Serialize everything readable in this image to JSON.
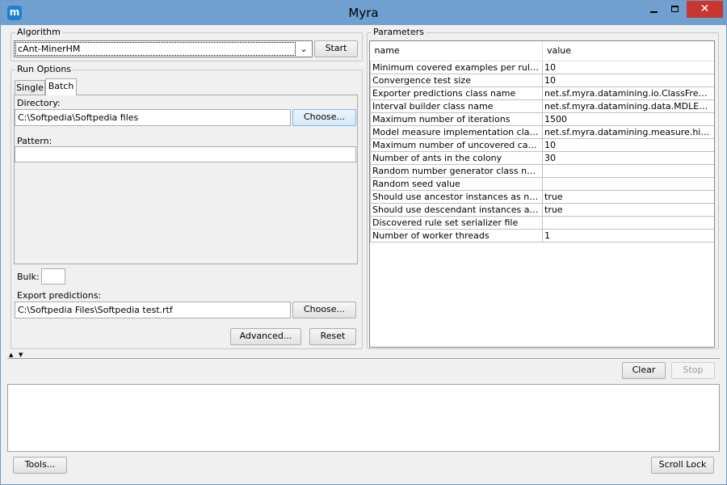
{
  "window": {
    "title": "Myra",
    "app_icon": "m",
    "close_glyph": "✕"
  },
  "algorithm": {
    "group_label": "Algorithm",
    "selected": "cAnt-MinerHM",
    "arrow": "⌄",
    "start_label": "Start"
  },
  "run_options": {
    "group_label": "Run Options",
    "tabs": [
      "Single",
      "Batch"
    ],
    "active_tab": "Batch",
    "directory_label": "Directory:",
    "directory_value": "C:\\Softpedia\\Softpedia files",
    "choose_label": "Choose...",
    "pattern_label": "Pattern:",
    "pattern_value": "",
    "bulk_label": "Bulk:",
    "bulk_value": "",
    "export_label": "Export predictions:",
    "export_value": "C:\\Softpedia Files\\Softpedia test.rtf",
    "export_choose_label": "Choose...",
    "advanced_label": "Advanced...",
    "reset_label": "Reset"
  },
  "parameters": {
    "group_label": "Parameters",
    "columns": [
      "name",
      "value"
    ],
    "rows": [
      {
        "name": "Minimum covered examples per rule value",
        "value": "10"
      },
      {
        "name": "Convergence test size",
        "value": "10"
      },
      {
        "name": "Exporter predictions class name",
        "value": "net.sf.myra.datamining.io.ClassFrequen..."
      },
      {
        "name": "Interval builder class name",
        "value": "net.sf.myra.datamining.data.MDLEntrop..."
      },
      {
        "name": "Maximum number of iterations",
        "value": "1500"
      },
      {
        "name": "Model measure implementation class name",
        "value": "net.sf.myra.datamining.measure.hierarc..."
      },
      {
        "name": "Maximum number of uncovered cases",
        "value": "10"
      },
      {
        "name": "Number of ants in the colony",
        "value": "30"
      },
      {
        "name": "Random number generator class name",
        "value": ""
      },
      {
        "name": "Random seed value",
        "value": ""
      },
      {
        "name": "Should use ancestor instances as negativ...",
        "value": "true"
      },
      {
        "name": "Should use descendant instances as posi...",
        "value": "true"
      },
      {
        "name": "Discovered rule set serializer file",
        "value": ""
      },
      {
        "name": "Number of worker threads",
        "value": "1"
      }
    ]
  },
  "splitter": {
    "up_arrow": "▲",
    "down_arrow": "▼"
  },
  "log": {
    "clear_label": "Clear",
    "stop_label": "Stop",
    "content": ""
  },
  "footer": {
    "tools_label": "Tools...",
    "scroll_lock_label": "Scroll Lock"
  }
}
